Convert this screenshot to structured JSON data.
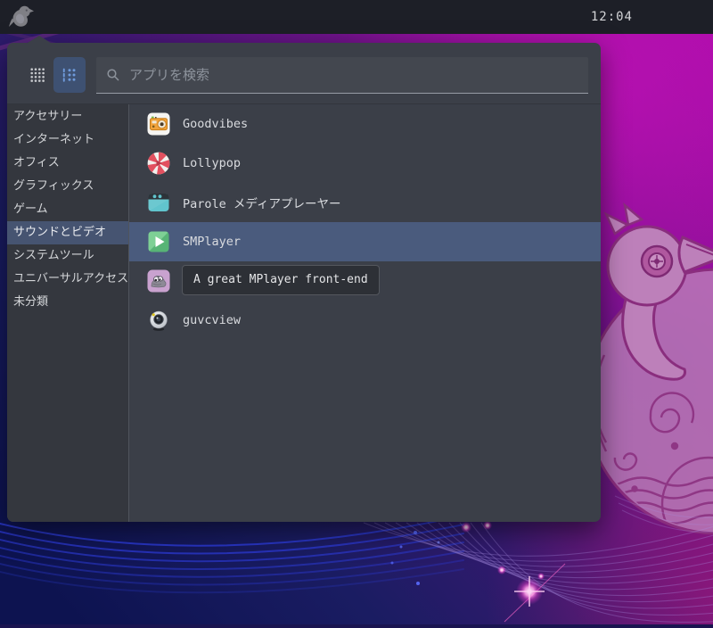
{
  "panel": {
    "clock": "12:04"
  },
  "menu": {
    "search_placeholder": "アプリを検索",
    "view_toggles": [
      {
        "name": "grid-view",
        "selected": false
      },
      {
        "name": "category-view",
        "selected": true
      }
    ],
    "categories": [
      {
        "label": "アクセサリー",
        "selected": false
      },
      {
        "label": "インターネット",
        "selected": false
      },
      {
        "label": "オフィス",
        "selected": false
      },
      {
        "label": "グラフィックス",
        "selected": false
      },
      {
        "label": "ゲーム",
        "selected": false
      },
      {
        "label": "サウンドとビデオ",
        "selected": true
      },
      {
        "label": "システムツール",
        "selected": false
      },
      {
        "label": "ユニバーサルアクセス",
        "selected": false
      },
      {
        "label": "未分類",
        "selected": false
      }
    ],
    "apps": [
      {
        "label": "Goodvibes",
        "icon": "goodvibes-icon",
        "highlighted": false
      },
      {
        "label": "Lollypop",
        "icon": "lollypop-icon",
        "highlighted": false
      },
      {
        "label": "Parole メディアプレーヤー",
        "icon": "parole-icon",
        "highlighted": false
      },
      {
        "label": "SMPlayer",
        "icon": "smplayer-icon",
        "highlighted": true
      },
      {
        "label": "",
        "icon": "purple-creature-icon",
        "highlighted": false
      },
      {
        "label": "guvcview",
        "icon": "guvcview-icon",
        "highlighted": false
      }
    ],
    "tooltip": "A great MPlayer front-end"
  },
  "colors": {
    "panel_bg": "#1d1f27",
    "menu_bg": "#3b3f48",
    "sidebar_bg": "#34373e",
    "selection_blue": "#4a5b7d",
    "accent_blue": "#6f9bdb",
    "wallpaper_magenta": "#a90ca8",
    "wallpaper_navy": "#0d1350"
  }
}
